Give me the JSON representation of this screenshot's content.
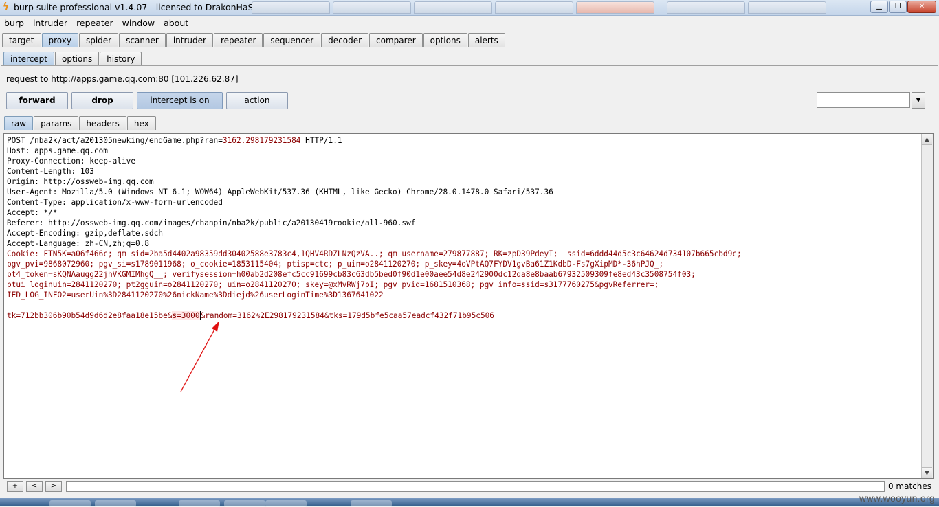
{
  "window": {
    "title": "burp suite professional v1.4.07 - licensed to DrakonHaSh",
    "min_label": "▁",
    "max_label": "❐",
    "close_label": "✕"
  },
  "menu": [
    "burp",
    "intruder",
    "repeater",
    "window",
    "about"
  ],
  "main_tabs": [
    "target",
    "proxy",
    "spider",
    "scanner",
    "intruder",
    "repeater",
    "sequencer",
    "decoder",
    "comparer",
    "options",
    "alerts"
  ],
  "proxy_tabs": [
    "intercept",
    "options",
    "history"
  ],
  "intercept": {
    "request_info": "request to http://apps.game.qq.com:80  [101.226.62.87]",
    "forward_label": "forward",
    "drop_label": "drop",
    "intercept_label": "intercept is on",
    "action_label": "action"
  },
  "message_tabs": [
    "raw",
    "params",
    "headers",
    "hex"
  ],
  "request": {
    "line1_pre": "POST /nba2k/act/a201305newking/endGame.php?ran=",
    "line1_val": "3162.298179231584",
    "line1_post": " HTTP/1.1",
    "host": "Host: apps.game.qq.com",
    "proxy_conn": "Proxy-Connection: keep-alive",
    "content_length": "Content-Length: 103",
    "origin": "Origin: http://ossweb-img.qq.com",
    "user_agent": "User-Agent: Mozilla/5.0 (Windows NT 6.1; WOW64) AppleWebKit/537.36 (KHTML, like Gecko) Chrome/28.0.1478.0 Safari/537.36",
    "content_type": "Content-Type: application/x-www-form-urlencoded",
    "accept": "Accept: */*",
    "referer": "Referer: http://ossweb-img.qq.com/images/chanpin/nba2k/public/a20130419rookie/all-960.swf",
    "accept_encoding": "Accept-Encoding: gzip,deflate,sdch",
    "accept_language": "Accept-Language: zh-CN,zh;q=0.8",
    "cookie1": "Cookie: FTN5K=a06f466c; qm_sid=2ba5d4402a98359dd30402588e3783c4,1QHV4RDZLNzQzVA..; qm_username=279877887; RK=zpD39PdeyI; _ssid=6ddd44d5c3c64624d734107b665cbd9c;",
    "cookie2": "pgv_pvi=9868072960; pgv_si=s1789011968; o_cookie=1853115404; ptisp=ctc; p_uin=o2841120270; p_skey=4oVPtAQ7FYDV1gvBa61Z1KdbD-Fs7gXipMD*-36hPJQ_;",
    "cookie3": "pt4_token=sKQNAaugg22jhVKGMIMhgQ__; verifysession=h00ab2d208efc5cc91699cb83c63db5bed0f90d1e00aee54d8e242900dc12da8e8baab67932509309fe8ed43c3508754f03;",
    "cookie4": "ptui_loginuin=2841120270; pt2gguin=o2841120270; uin=o2841120270; skey=@xMvRWj7pI; pgv_pvid=1681510368; pgv_info=ssid=s3177760275&pgvReferrer=;",
    "cookie5": "IED_LOG_INFO2=userUin%3D2841120270%26nickName%3Ddiejd%26userLoginTime%3D1367641022",
    "body_pre": "tk=712bb306b90b54d9d6d2e8faa18e15be&",
    "body_hl": "s=3000",
    "body_post": "&random=3162%2E298179231584&tks=179d5bfe5caa57eadcf432f71b95c506"
  },
  "search": {
    "plus_label": "+",
    "prev_label": "<",
    "next_label": ">",
    "matches": "0 matches"
  },
  "watermark": "www.wooyun.org",
  "colors": {
    "value_text": "#8b0000",
    "arrow": "#e01010",
    "active_tab": "#b8cfe8"
  }
}
